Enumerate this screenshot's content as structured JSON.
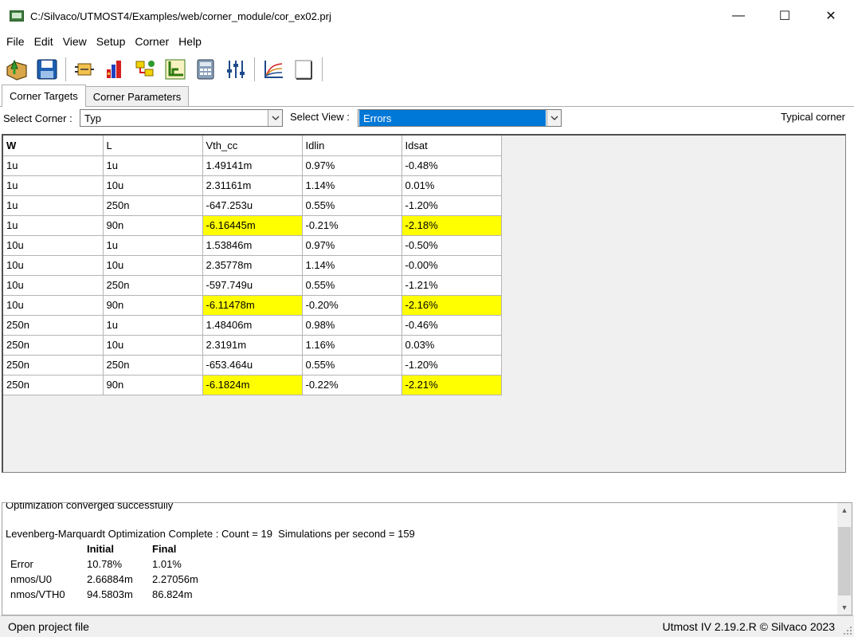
{
  "window": {
    "title": "C:/Silvaco/UTMOST4/Examples/web/corner_module/cor_ex02.prj",
    "minimize": "—",
    "maximize": "☐",
    "close": "✕"
  },
  "menu": [
    "File",
    "Edit",
    "View",
    "Setup",
    "Corner",
    "Help"
  ],
  "toolbar": {
    "icons": [
      "open-project-icon",
      "save-icon",
      "setup-module-icon",
      "bar-chart-icon",
      "tree-flow-icon",
      "axis-chart-icon",
      "calculator-icon",
      "sliders-icon",
      "curve-plot-icon",
      "blank-page-icon"
    ]
  },
  "tabs": [
    {
      "label": "Corner Targets",
      "active": true
    },
    {
      "label": "Corner Parameters",
      "active": false
    }
  ],
  "select_corner": {
    "label": "Select Corner :",
    "value": "Typ"
  },
  "select_view": {
    "label": "Select View :",
    "value": "Errors"
  },
  "typical_label": "Typical corner",
  "grid": {
    "headers": [
      "W",
      "L",
      "Vth_cc",
      "Idlin",
      "Idsat"
    ],
    "rows": [
      {
        "cells": [
          "1u",
          "1u",
          "1.49141m",
          " 0.97%",
          "-0.48%"
        ],
        "hl": []
      },
      {
        "cells": [
          "1u",
          "10u",
          "2.31161m",
          " 1.14%",
          " 0.01%"
        ],
        "hl": []
      },
      {
        "cells": [
          "1u",
          "250n",
          "-647.253u",
          " 0.55%",
          "-1.20%"
        ],
        "hl": []
      },
      {
        "cells": [
          "1u",
          "90n",
          "-6.16445m",
          "-0.21%",
          "-2.18%"
        ],
        "hl": [
          2,
          4
        ]
      },
      {
        "cells": [
          "10u",
          "1u",
          "1.53846m",
          " 0.97%",
          "-0.50%"
        ],
        "hl": []
      },
      {
        "cells": [
          "10u",
          "10u",
          "2.35778m",
          " 1.14%",
          "-0.00%"
        ],
        "hl": []
      },
      {
        "cells": [
          "10u",
          "250n",
          "-597.749u",
          " 0.55%",
          "-1.21%"
        ],
        "hl": []
      },
      {
        "cells": [
          "10u",
          "90n",
          "-6.11478m",
          "-0.20%",
          "-2.16%"
        ],
        "hl": [
          2,
          4
        ]
      },
      {
        "cells": [
          "250n",
          "1u",
          "1.48406m",
          " 0.98%",
          "-0.46%"
        ],
        "hl": []
      },
      {
        "cells": [
          "250n",
          "10u",
          "2.3191m",
          " 1.16%",
          " 0.03%"
        ],
        "hl": []
      },
      {
        "cells": [
          "250n",
          "250n",
          "-653.464u",
          " 0.55%",
          "-1.20%"
        ],
        "hl": []
      },
      {
        "cells": [
          "250n",
          "90n",
          "-6.1824m",
          "-0.22%",
          "-2.21%"
        ],
        "hl": [
          2,
          4
        ]
      }
    ]
  },
  "log": {
    "partial_line": "Optimization converged successfully",
    "summary": "Levenberg-Marquardt Optimization Complete : Count = 19  Simulations per second = 159",
    "table": {
      "headers": [
        "",
        "Initial",
        "Final"
      ],
      "rows": [
        [
          "Error",
          "10.78%",
          "1.01%"
        ],
        [
          "nmos/U0",
          "2.66884m",
          "2.27056m"
        ],
        [
          "nmos/VTH0",
          "94.5803m",
          "86.824m"
        ]
      ]
    }
  },
  "status": {
    "left": "Open project file",
    "right": "Utmost IV 2.19.2.R © Silvaco 2023"
  },
  "colors": {
    "highlight": "#ffff00",
    "selection": "#0078d7"
  }
}
